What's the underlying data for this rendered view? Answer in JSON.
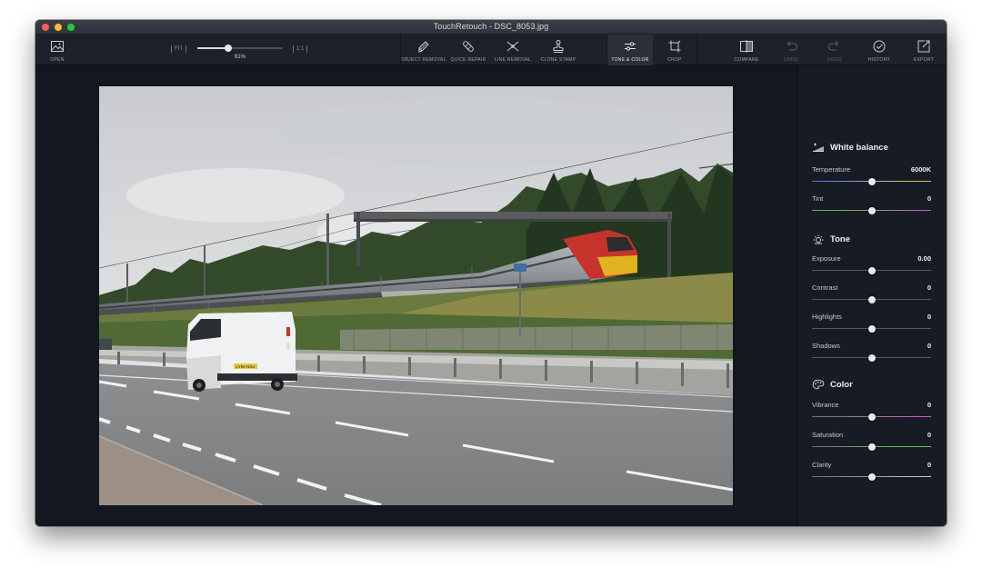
{
  "window": {
    "title": "TouchRetouch - DSC_8053.jpg"
  },
  "toolbar": {
    "open_label": "OPEN",
    "zoom": {
      "fit_label": "FIT",
      "one_to_one_label": "1:1",
      "value_label": "81%",
      "value": 0.81
    },
    "tools": [
      {
        "label": "OBJECT REMOVAL",
        "icon": "object-removal-icon"
      },
      {
        "label": "QUICK REPAIR",
        "icon": "bandage-icon"
      },
      {
        "label": "LINE REMOVAL",
        "icon": "line-removal-icon"
      },
      {
        "label": "CLONE STAMP",
        "icon": "clone-stamp-icon"
      },
      {
        "label": "TONE & COLOR",
        "icon": "sliders-icon",
        "active": true
      },
      {
        "label": "CROP",
        "icon": "crop-icon"
      }
    ],
    "right_tools": [
      {
        "label": "COMPARE",
        "icon": "compare-icon"
      },
      {
        "label": "UNDO",
        "icon": "undo-icon",
        "disabled": true
      },
      {
        "label": "REDO",
        "icon": "redo-icon",
        "disabled": true
      },
      {
        "label": "HISTORY",
        "icon": "history-icon"
      },
      {
        "label": "EXPORT",
        "icon": "export-icon"
      }
    ]
  },
  "photo": {
    "van_plate": "LY65 NSU"
  },
  "panel": {
    "white_balance": {
      "title": "White balance",
      "icon": "white-balance-icon",
      "controls": [
        {
          "label": "Temperature",
          "value": "6000K",
          "position": 0.5,
          "track": "temperature"
        },
        {
          "label": "Tint",
          "value": "0",
          "position": 0.5,
          "track": "tint"
        }
      ]
    },
    "tone": {
      "title": "Tone",
      "icon": "sun-icon",
      "controls": [
        {
          "label": "Exposure",
          "value": "0.00",
          "position": 0.5
        },
        {
          "label": "Contrast",
          "value": "0",
          "position": 0.5
        },
        {
          "label": "Highlights",
          "value": "0",
          "position": 0.5
        },
        {
          "label": "Shadows",
          "value": "0",
          "position": 0.5
        }
      ]
    },
    "color": {
      "title": "Color",
      "icon": "palette-icon",
      "controls": [
        {
          "label": "Vibrance",
          "value": "0",
          "position": 0.5,
          "track": "vibrance"
        },
        {
          "label": "Saturation",
          "value": "0",
          "position": 0.5,
          "track": "saturation"
        },
        {
          "label": "Clarity",
          "value": "0",
          "position": 0.5
        }
      ]
    }
  },
  "colors": {
    "window_bg": "#12161f",
    "toolbar_bg": "#1d212a",
    "panel_bg": "#171b23",
    "active_tool_bg": "#2a2f3a",
    "thumb": "#e8eaee"
  }
}
